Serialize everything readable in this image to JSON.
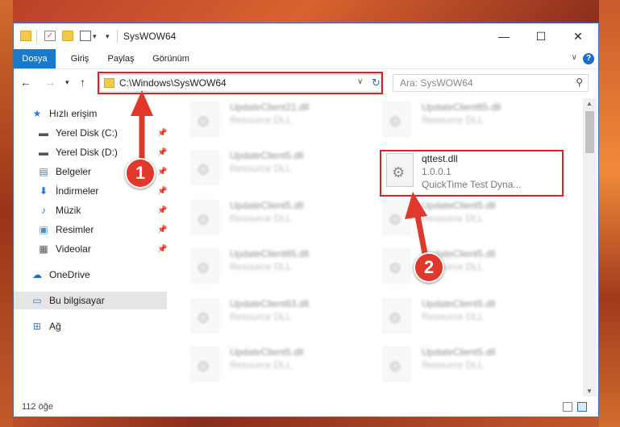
{
  "window": {
    "title": "SysWOW64",
    "controls": {
      "minimize": "—",
      "maximize": "☐",
      "close": "✕"
    }
  },
  "ribbon": {
    "tabs": [
      "Dosya",
      "Giriş",
      "Paylaş",
      "Görünüm"
    ],
    "help": "?"
  },
  "address": {
    "path": "C:\\Windows\\SysWOW64",
    "search_placeholder": "Ara: SysWOW64"
  },
  "nav": {
    "quick_access": "Hızlı erişim",
    "items": [
      {
        "label": "Yerel Disk (C:)",
        "icon": "drive-icon"
      },
      {
        "label": "Yerel Disk (D:)",
        "icon": "drive-icon"
      },
      {
        "label": "Belgeler",
        "icon": "documents-icon"
      },
      {
        "label": "İndirmeler",
        "icon": "downloads-icon"
      },
      {
        "label": "Müzik",
        "icon": "music-icon"
      },
      {
        "label": "Resimler",
        "icon": "pictures-icon"
      },
      {
        "label": "Videolar",
        "icon": "videos-icon"
      }
    ],
    "onedrive": "OneDrive",
    "this_pc": "Bu bilgisayar",
    "network": "Ağ"
  },
  "files": {
    "left_column": [
      {
        "name": "UpdateClient21.dll",
        "desc": "Resource DLL"
      },
      {
        "name": "UpdateClient5.dll",
        "desc": "Resource DLL"
      },
      {
        "name": "UpdateClient5.dll",
        "desc": "Resource DLL"
      },
      {
        "name": "UpdateClient65.dll",
        "desc": "Resource DLL"
      },
      {
        "name": "UpdateClient63.dll",
        "desc": "Resource DLL"
      },
      {
        "name": "UpdateClient5.dll",
        "desc": "Resource DLL"
      }
    ],
    "right_column": [
      {
        "name": "UpdateClient65.dll",
        "desc": "Resource DLL"
      },
      {
        "name": "UpdateClient5.dll",
        "desc": "Resource DLL"
      },
      {
        "name": "UpdateClient5.dll",
        "desc": "Resource DLL"
      },
      {
        "name": "UpdateClient5.dll",
        "desc": "Resource DLL"
      },
      {
        "name": "UpdateClient5.dll",
        "desc": "Resource DLL"
      }
    ],
    "selected": {
      "name": "qttest.dll",
      "version": "1.0.0.1",
      "description": "QuickTime Test Dyna..."
    }
  },
  "status": {
    "item_count": "112 öğe"
  },
  "annotations": {
    "step1": "1",
    "step2": "2",
    "color": "#e0392c"
  }
}
